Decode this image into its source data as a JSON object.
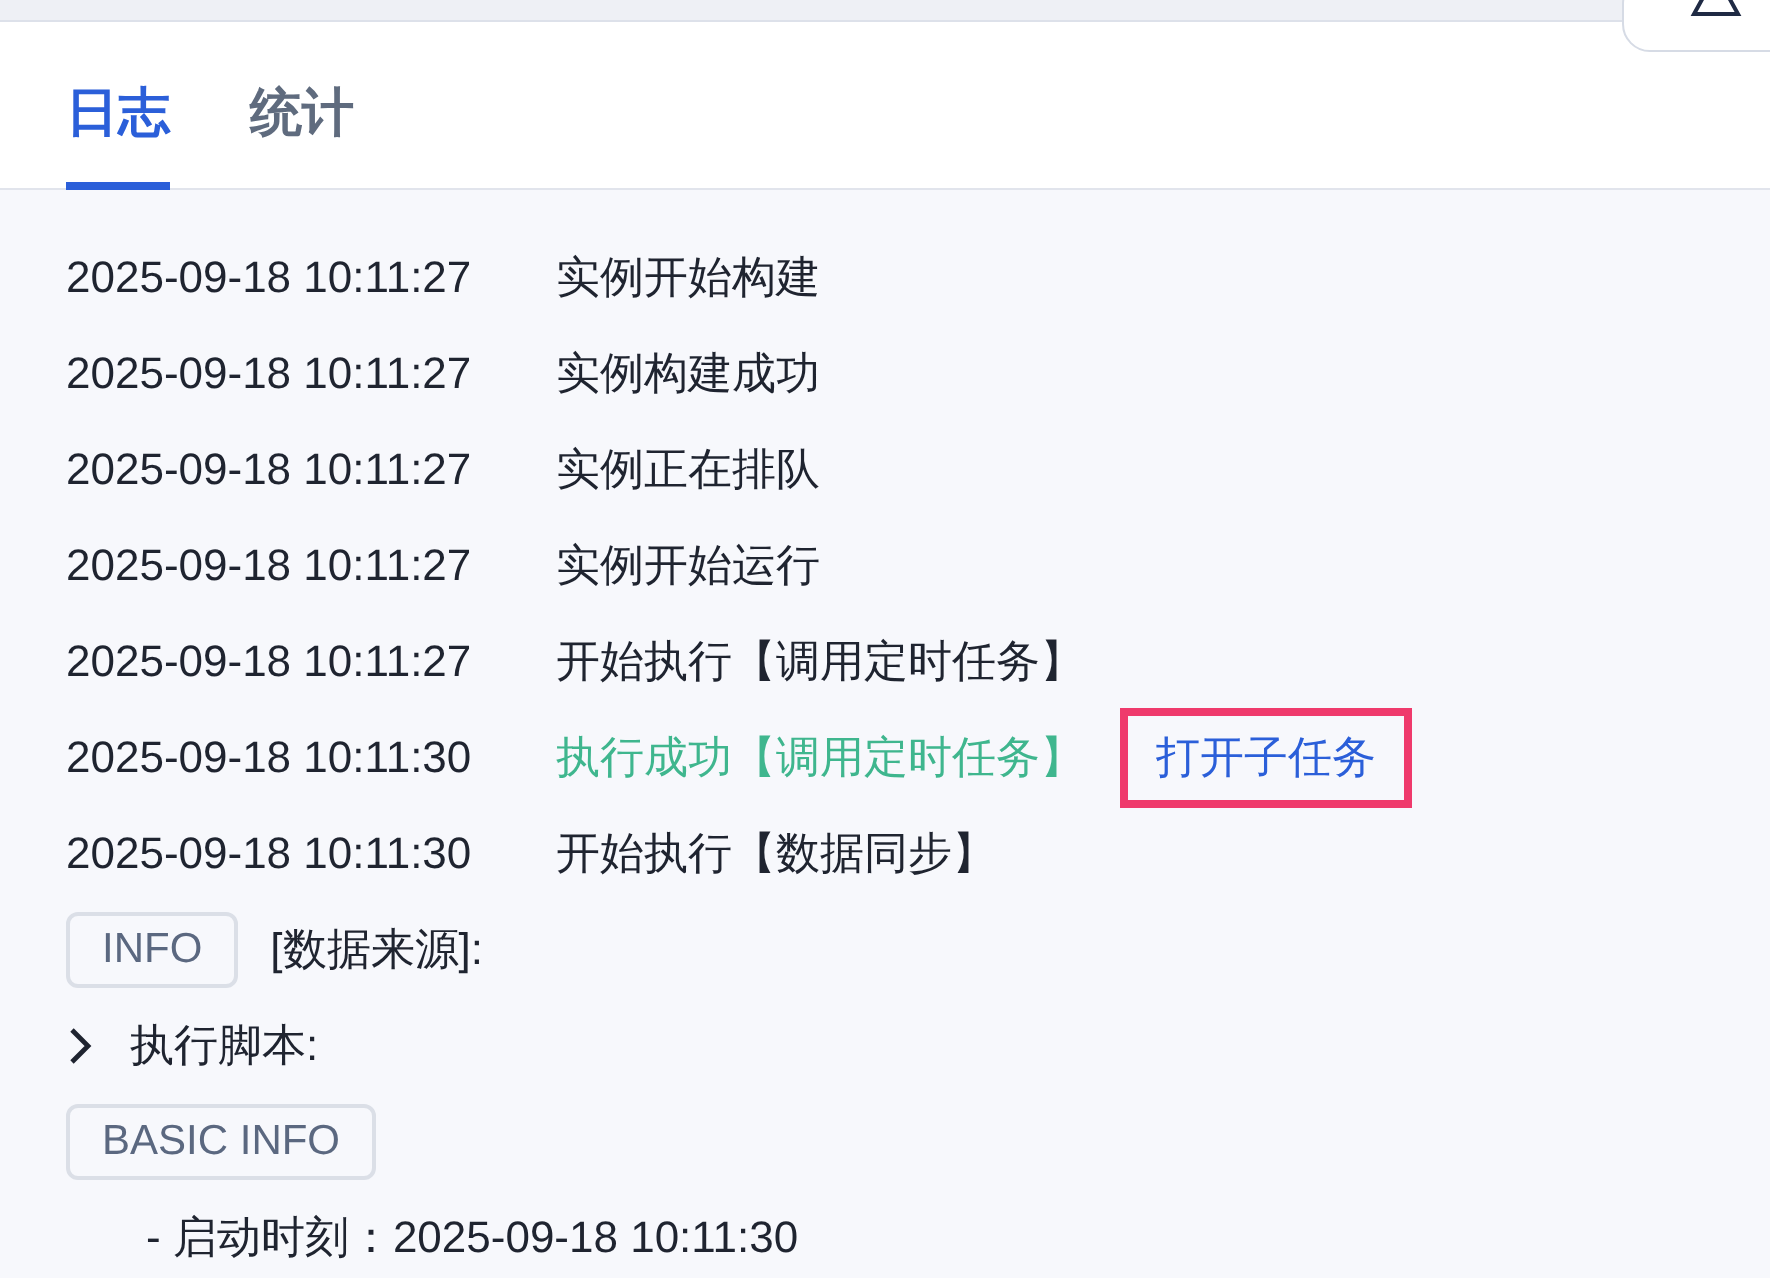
{
  "tabs": [
    {
      "label": "日志",
      "selected": true
    },
    {
      "label": "统计",
      "selected": false
    }
  ],
  "entries": [
    {
      "kind": "log",
      "time": "2025-09-18 10:11:27",
      "message": "实例开始构建",
      "success": false
    },
    {
      "kind": "log",
      "time": "2025-09-18 10:11:27",
      "message": "实例构建成功",
      "success": false
    },
    {
      "kind": "log",
      "time": "2025-09-18 10:11:27",
      "message": "实例正在排队",
      "success": false
    },
    {
      "kind": "log",
      "time": "2025-09-18 10:11:27",
      "message": "实例开始运行",
      "success": false
    },
    {
      "kind": "log",
      "time": "2025-09-18 10:11:27",
      "message": "开始执行【调用定时任务】",
      "success": false
    },
    {
      "kind": "log",
      "time": "2025-09-18 10:11:30",
      "message": "执行成功【调用定时任务】",
      "success": true,
      "link": {
        "label": "打开子任务",
        "highlighted": true
      }
    },
    {
      "kind": "log",
      "time": "2025-09-18 10:11:30",
      "message": "开始执行【数据同步】",
      "success": false
    },
    {
      "kind": "tag",
      "tag": "INFO",
      "text": "[数据来源]:"
    },
    {
      "kind": "toggle",
      "label": "执行脚本:",
      "expanded": false
    },
    {
      "kind": "tag",
      "tag": "BASIC INFO"
    },
    {
      "kind": "detail",
      "text": "- 启动时刻：2025-09-18 10:11:30"
    }
  ]
}
